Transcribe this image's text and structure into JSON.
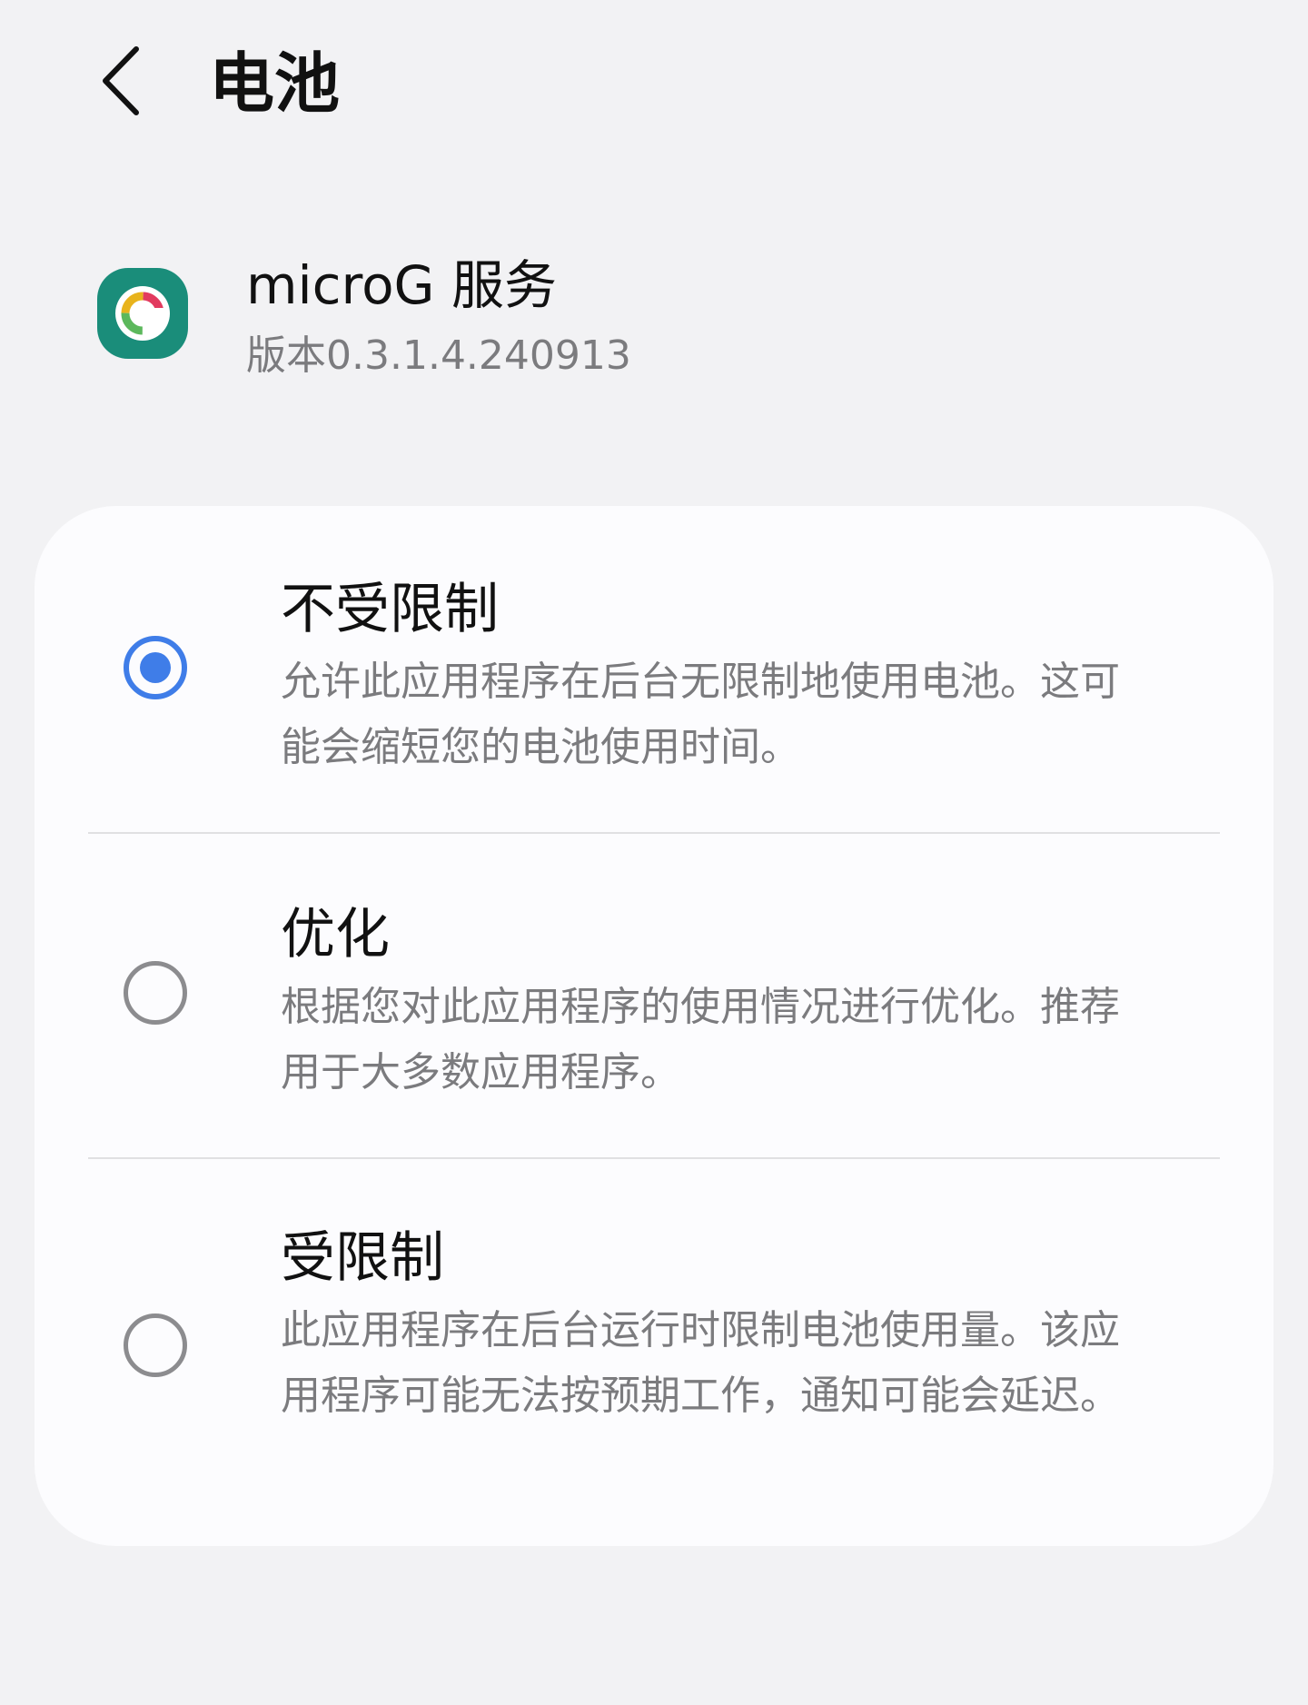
{
  "header": {
    "back_icon": "chevron-left-icon",
    "title": "电池"
  },
  "app": {
    "icon": "microg-app-icon",
    "name": "microG 服务",
    "version": "版本0.3.1.4.240913"
  },
  "battery_options": [
    {
      "title": "不受限制",
      "description": "允许此应用程序在后台无限制地使用电池。这可能会缩短您的电池使用时间。",
      "selected": true
    },
    {
      "title": "优化",
      "description": "根据您对此应用程序的使用情况进行优化。推荐用于大多数应用程序。",
      "selected": false
    },
    {
      "title": "受限制",
      "description": "此应用程序在后台运行时限制电池使用量。该应用程序可能无法按预期工作，通知可能会延迟。",
      "selected": false
    }
  ],
  "colors": {
    "accent": "#3f7de8",
    "background": "#f2f2f4",
    "card": "#fcfcfe",
    "secondary_text": "#7b7b7e",
    "icon_teal": "#1a8d7a"
  }
}
